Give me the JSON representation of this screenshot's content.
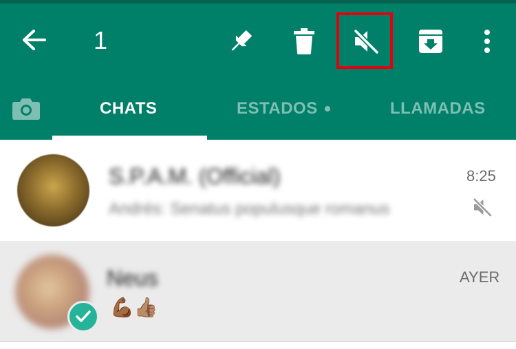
{
  "selection": {
    "count": "1"
  },
  "actions": [
    "back-icon",
    "pin-icon",
    "delete-icon",
    "mute-icon",
    "archive-icon",
    "more-vert-icon"
  ],
  "tabs": [
    {
      "label": "CHATS",
      "active": true
    },
    {
      "label": "ESTADOS",
      "active": false
    },
    {
      "label": "LLAMADAS",
      "active": false
    }
  ],
  "chats": [
    {
      "name": "S.P.A.M. (Official)",
      "last_message": "Andrés: Senatus populusque romanus",
      "time": "8:25",
      "muted": true
    },
    {
      "name": "Neus",
      "last_message": "💪🏾👍🏽",
      "time": "AYER",
      "selected": true
    }
  ],
  "colors": {
    "header": "#008069",
    "highlight": "#e3000f",
    "check": "#25b39a"
  }
}
